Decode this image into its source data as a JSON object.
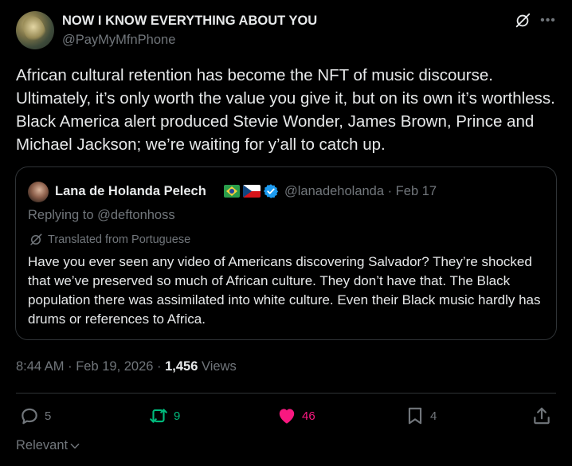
{
  "author": {
    "display_name": "NOW I KNOW EVERYTHING ABOUT YOU",
    "handle": "@PayMyMfnPhone"
  },
  "tweet": {
    "text": "African cultural retention has become the NFT of music discourse. Ultimately, it’s only worth the value you give it, but on its own it’s worthless. Black America alert produced Stevie Wonder, James Brown, Prince and Michael Jackson; we’re waiting for y’all to catch up.",
    "time": "8:44 AM · Feb 19, 2026 · ",
    "views_count": "1,456",
    "views_label": " Views"
  },
  "quote": {
    "display_name": "Lana de Holanda Pelech",
    "flags": [
      "brazil-flag",
      "czech-flag"
    ],
    "handle_date": "@lanadeholanda · Feb 17",
    "replying_to": "Replying to @deftonhoss",
    "translated": "Translated from Portuguese",
    "text": "Have you ever seen any video of Americans discovering Salvador? They’re shocked that we’ve preserved so much of African culture. They don’t have that. The Black population there was assimilated into white culture. Even their Black music hardly has drums or references to Africa."
  },
  "actions": {
    "replies": "5",
    "reposts": "9",
    "likes": "46",
    "bookmarks": "4"
  },
  "sort": {
    "label": "Relevant"
  },
  "colors": {
    "background": "#000000",
    "text": "#e7e9ea",
    "muted": "#71767b",
    "border": "#2f3336",
    "repost_active": "#00ba7c",
    "like_active": "#f91880",
    "verified": "#1d9bf0"
  },
  "icons": [
    "grok-icon",
    "more-icon",
    "verified-icon",
    "translate-icon",
    "reply-icon",
    "repost-icon",
    "heart-icon",
    "bookmark-icon",
    "share-icon",
    "chevron-down-icon"
  ]
}
